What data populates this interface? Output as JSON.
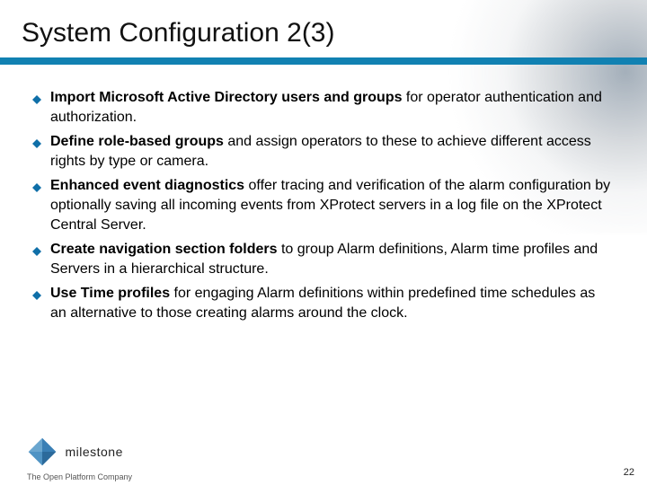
{
  "title": "System Configuration 2(3)",
  "bullets": [
    {
      "lead": "Import Microsoft Active Directory users and groups",
      "rest": " for operator authentication and authorization."
    },
    {
      "lead": "Define role-based groups",
      "rest": " and assign operators to these to achieve different access rights by type or camera."
    },
    {
      "lead": "Enhanced event diagnostics",
      "rest": " offer tracing and verification of the alarm configuration by optionally saving all incoming events from XProtect servers in a log file on the XProtect Central Server."
    },
    {
      "lead": "Create navigation section folders",
      "rest": " to group Alarm definitions, Alarm time profiles and Servers in a hierarchical structure."
    },
    {
      "lead": "Use Time profiles",
      "rest": " for engaging Alarm definitions within predefined time schedules as an alternative to those creating alarms around the clock."
    }
  ],
  "logo": {
    "brand": "milestone",
    "tagline": "The Open Platform Company"
  },
  "page_number": "22",
  "colors": {
    "accent": "#1181b2",
    "diamond": "#3a7fb5"
  }
}
